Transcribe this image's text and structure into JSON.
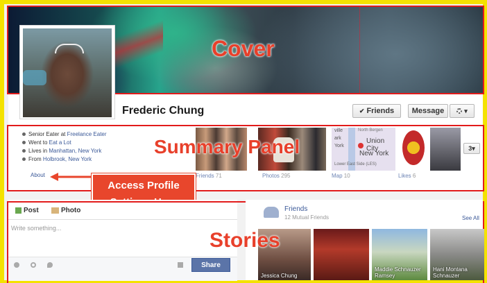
{
  "annotations": {
    "cover": "Cover",
    "summary": "Summary Panel",
    "stories": "Stories",
    "callout_line1": "Access Profile",
    "callout_line2": "Settings Here"
  },
  "profile": {
    "name": "Frederic Chung",
    "friends_button": "Friends",
    "friends_check": "✔",
    "message_button": "Message",
    "gear_caret": "▾"
  },
  "info": {
    "work_prefix": "Senior Eater at",
    "work_link": "Freelance Eater",
    "school_prefix": "Went to",
    "school_link": "Eat a Lot",
    "lives_prefix": "Lives in",
    "lives_link": "Manhattan, New York",
    "from_prefix": "From",
    "from_link": "Holbrook, New York",
    "about_link": "About"
  },
  "tiles": {
    "friends_label": "Friends",
    "friends_count": "71",
    "photos_label": "Photos",
    "photos_count": "295",
    "map_label": "Map",
    "map_count": "10",
    "likes_label": "Likes",
    "likes_count": "6",
    "more_count": "3",
    "map_text": [
      "ville",
      "ark",
      "York",
      "North Bergen",
      "Union City",
      "New York",
      "Lower East Side (LES)"
    ]
  },
  "composer": {
    "post_tab": "Post",
    "photo_tab": "Photo",
    "placeholder": "Write something...",
    "share_button": "Share"
  },
  "friends_panel": {
    "title": "Friends",
    "subtitle": "12 Mutual Friends",
    "see_all": "See All",
    "people": [
      "Jessica Chung",
      "",
      "Maddie Schnauzer Ramsey",
      "Hani Montana Schnauzer"
    ]
  },
  "colors": {
    "annotation_red": "#e21b1b",
    "callout": "#e8462c",
    "share_blue": "#5b74a8",
    "link_blue": "#3b5998"
  }
}
